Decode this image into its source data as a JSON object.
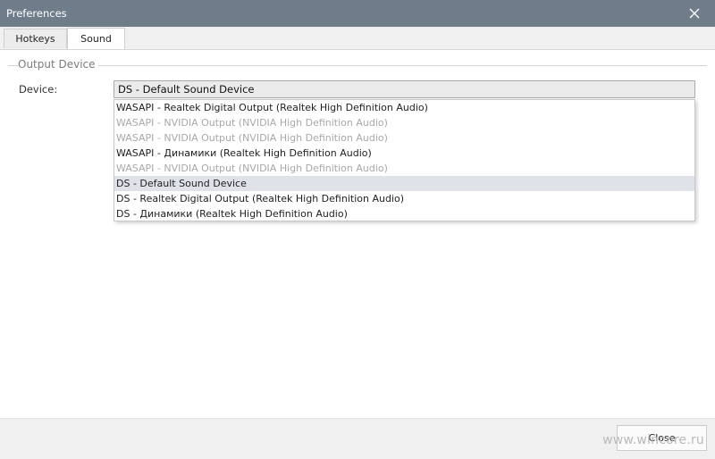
{
  "window": {
    "title": "Preferences"
  },
  "tabs": [
    {
      "label": "Hotkeys",
      "active": false
    },
    {
      "label": "Sound",
      "active": true
    }
  ],
  "output_device": {
    "group_title": "Output Device",
    "device_label": "Device:",
    "selected_value": "DS - Default Sound Device",
    "options": [
      {
        "label": "WASAPI - Realtek Digital Output (Realtek High Definition Audio)",
        "enabled": true
      },
      {
        "label": "WASAPI - NVIDIA Output (NVIDIA High Definition Audio)",
        "enabled": false
      },
      {
        "label": "WASAPI - NVIDIA Output (NVIDIA High Definition Audio)",
        "enabled": false
      },
      {
        "label": "WASAPI - Динамики (Realtek High Definition Audio)",
        "enabled": true
      },
      {
        "label": "WASAPI - NVIDIA Output (NVIDIA High Definition Audio)",
        "enabled": false
      },
      {
        "label": "DS - Default Sound Device",
        "enabled": true,
        "highlighted": true
      },
      {
        "label": "DS - Realtek Digital Output (Realtek High Definition Audio)",
        "enabled": true
      },
      {
        "label": "DS - Динамики (Realtek High Definition Audio)",
        "enabled": true
      }
    ]
  },
  "footer": {
    "close_label": "Close"
  },
  "watermark": "www.wincore.ru",
  "colors": {
    "titlebar": "#6f7d8b",
    "selected_row": "#dfe3e9",
    "disabled_text": "#a8a8a8"
  }
}
